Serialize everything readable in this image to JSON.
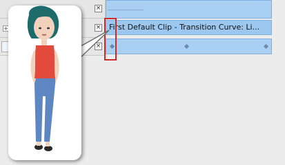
{
  "clip": {
    "label": "First Default Clip - Transition Curve: Li..."
  },
  "icons": {
    "close": "×",
    "expand": "+"
  },
  "colors": {
    "track": "#a9cff2",
    "highlight": "#cc2b2b"
  }
}
